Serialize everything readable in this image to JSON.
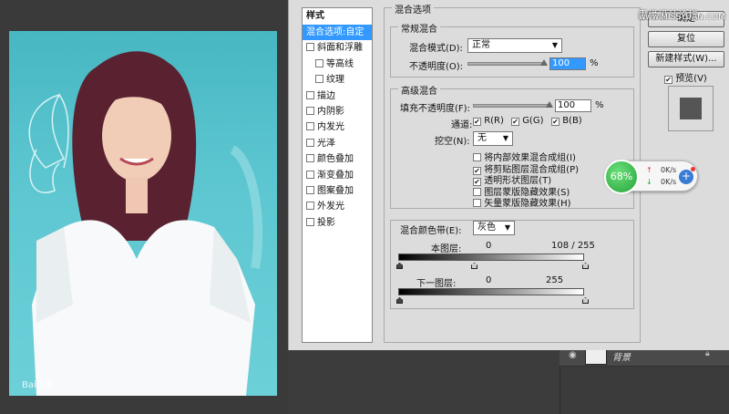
{
  "watermark": {
    "site": "思缘设计论坛",
    "url": "www.MISSYUAN.COM",
    "photo_credit": "Bai百度"
  },
  "styles_panel": {
    "title": "样式",
    "items": [
      {
        "label": "混合选项:自定",
        "checkbox": false,
        "selected": true,
        "indent": false
      },
      {
        "label": "斜面和浮雕",
        "checkbox": true,
        "selected": false,
        "indent": false
      },
      {
        "label": "等高线",
        "checkbox": true,
        "selected": false,
        "indent": true
      },
      {
        "label": "纹理",
        "checkbox": true,
        "selected": false,
        "indent": true
      },
      {
        "label": "描边",
        "checkbox": true,
        "selected": false,
        "indent": false
      },
      {
        "label": "内阴影",
        "checkbox": true,
        "selected": false,
        "indent": false
      },
      {
        "label": "内发光",
        "checkbox": true,
        "selected": false,
        "indent": false
      },
      {
        "label": "光泽",
        "checkbox": true,
        "selected": false,
        "indent": false
      },
      {
        "label": "颜色叠加",
        "checkbox": true,
        "selected": false,
        "indent": false
      },
      {
        "label": "渐变叠加",
        "checkbox": true,
        "selected": false,
        "indent": false
      },
      {
        "label": "图案叠加",
        "checkbox": true,
        "selected": false,
        "indent": false
      },
      {
        "label": "外发光",
        "checkbox": true,
        "selected": false,
        "indent": false
      },
      {
        "label": "投影",
        "checkbox": true,
        "selected": false,
        "indent": false
      }
    ]
  },
  "blending": {
    "section_title": "混合选项",
    "general_title": "常规混合",
    "mode_label": "混合模式(D):",
    "mode_value": "正常",
    "opacity_label": "不透明度(O):",
    "opacity_value": "100",
    "percent": "%",
    "advanced_title": "高级混合",
    "fill_label": "填充不透明度(F):",
    "fill_value": "100",
    "channels_label": "通道:",
    "channel_r": "R(R)",
    "channel_g": "G(G)",
    "channel_b": "B(B)",
    "knockout_label": "挖空(N):",
    "knockout_value": "无",
    "options": [
      {
        "label": "将内部效果混合成组(I)",
        "checked": false
      },
      {
        "label": "将剪贴图层混合成组(P)",
        "checked": true
      },
      {
        "label": "透明形状图层(T)",
        "checked": true
      },
      {
        "label": "图层蒙版隐藏效果(S)",
        "checked": false
      },
      {
        "label": "矢量蒙版隐藏效果(H)",
        "checked": false
      }
    ],
    "blend_if_label": "混合颜色带(E):",
    "blend_if_value": "灰色",
    "this_layer_label": "本图层:",
    "this_layer_low": "0",
    "this_layer_high": "108  /  255",
    "underlying_label": "下一图层:",
    "underlying_low": "0",
    "underlying_high": "255"
  },
  "buttons": {
    "ok": "确定",
    "reset": "复位",
    "new_style": "新建样式(W)...",
    "preview": "预览(V)"
  },
  "layers": {
    "layer_name": "背景"
  },
  "network_widget": {
    "percent": "68%",
    "up": "0K/s",
    "down": "0K/s"
  },
  "colors": {
    "accent": "#3399ff",
    "dialog_bg": "#dcdcdc",
    "photo_bg": "#5cc6d0"
  }
}
